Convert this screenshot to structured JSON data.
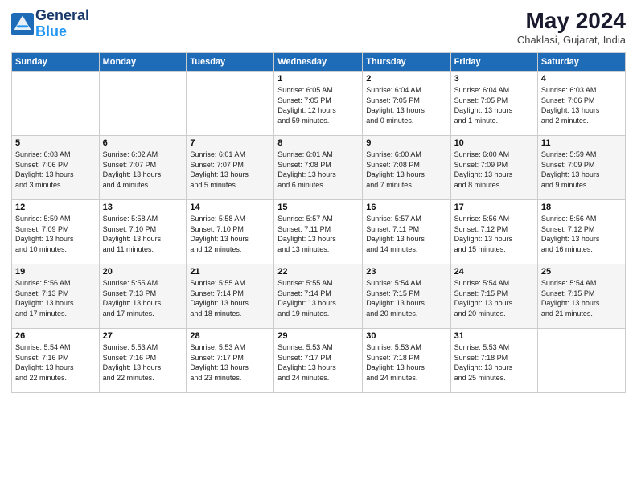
{
  "logo": {
    "line1": "General",
    "line2": "Blue"
  },
  "title": "May 2024",
  "location": "Chaklasi, Gujarat, India",
  "days_header": [
    "Sunday",
    "Monday",
    "Tuesday",
    "Wednesday",
    "Thursday",
    "Friday",
    "Saturday"
  ],
  "weeks": [
    [
      {
        "day": "",
        "info": ""
      },
      {
        "day": "",
        "info": ""
      },
      {
        "day": "",
        "info": ""
      },
      {
        "day": "1",
        "info": "Sunrise: 6:05 AM\nSunset: 7:05 PM\nDaylight: 12 hours\nand 59 minutes."
      },
      {
        "day": "2",
        "info": "Sunrise: 6:04 AM\nSunset: 7:05 PM\nDaylight: 13 hours\nand 0 minutes."
      },
      {
        "day": "3",
        "info": "Sunrise: 6:04 AM\nSunset: 7:05 PM\nDaylight: 13 hours\nand 1 minute."
      },
      {
        "day": "4",
        "info": "Sunrise: 6:03 AM\nSunset: 7:06 PM\nDaylight: 13 hours\nand 2 minutes."
      }
    ],
    [
      {
        "day": "5",
        "info": "Sunrise: 6:03 AM\nSunset: 7:06 PM\nDaylight: 13 hours\nand 3 minutes."
      },
      {
        "day": "6",
        "info": "Sunrise: 6:02 AM\nSunset: 7:07 PM\nDaylight: 13 hours\nand 4 minutes."
      },
      {
        "day": "7",
        "info": "Sunrise: 6:01 AM\nSunset: 7:07 PM\nDaylight: 13 hours\nand 5 minutes."
      },
      {
        "day": "8",
        "info": "Sunrise: 6:01 AM\nSunset: 7:08 PM\nDaylight: 13 hours\nand 6 minutes."
      },
      {
        "day": "9",
        "info": "Sunrise: 6:00 AM\nSunset: 7:08 PM\nDaylight: 13 hours\nand 7 minutes."
      },
      {
        "day": "10",
        "info": "Sunrise: 6:00 AM\nSunset: 7:09 PM\nDaylight: 13 hours\nand 8 minutes."
      },
      {
        "day": "11",
        "info": "Sunrise: 5:59 AM\nSunset: 7:09 PM\nDaylight: 13 hours\nand 9 minutes."
      }
    ],
    [
      {
        "day": "12",
        "info": "Sunrise: 5:59 AM\nSunset: 7:09 PM\nDaylight: 13 hours\nand 10 minutes."
      },
      {
        "day": "13",
        "info": "Sunrise: 5:58 AM\nSunset: 7:10 PM\nDaylight: 13 hours\nand 11 minutes."
      },
      {
        "day": "14",
        "info": "Sunrise: 5:58 AM\nSunset: 7:10 PM\nDaylight: 13 hours\nand 12 minutes."
      },
      {
        "day": "15",
        "info": "Sunrise: 5:57 AM\nSunset: 7:11 PM\nDaylight: 13 hours\nand 13 minutes."
      },
      {
        "day": "16",
        "info": "Sunrise: 5:57 AM\nSunset: 7:11 PM\nDaylight: 13 hours\nand 14 minutes."
      },
      {
        "day": "17",
        "info": "Sunrise: 5:56 AM\nSunset: 7:12 PM\nDaylight: 13 hours\nand 15 minutes."
      },
      {
        "day": "18",
        "info": "Sunrise: 5:56 AM\nSunset: 7:12 PM\nDaylight: 13 hours\nand 16 minutes."
      }
    ],
    [
      {
        "day": "19",
        "info": "Sunrise: 5:56 AM\nSunset: 7:13 PM\nDaylight: 13 hours\nand 17 minutes."
      },
      {
        "day": "20",
        "info": "Sunrise: 5:55 AM\nSunset: 7:13 PM\nDaylight: 13 hours\nand 17 minutes."
      },
      {
        "day": "21",
        "info": "Sunrise: 5:55 AM\nSunset: 7:14 PM\nDaylight: 13 hours\nand 18 minutes."
      },
      {
        "day": "22",
        "info": "Sunrise: 5:55 AM\nSunset: 7:14 PM\nDaylight: 13 hours\nand 19 minutes."
      },
      {
        "day": "23",
        "info": "Sunrise: 5:54 AM\nSunset: 7:15 PM\nDaylight: 13 hours\nand 20 minutes."
      },
      {
        "day": "24",
        "info": "Sunrise: 5:54 AM\nSunset: 7:15 PM\nDaylight: 13 hours\nand 20 minutes."
      },
      {
        "day": "25",
        "info": "Sunrise: 5:54 AM\nSunset: 7:15 PM\nDaylight: 13 hours\nand 21 minutes."
      }
    ],
    [
      {
        "day": "26",
        "info": "Sunrise: 5:54 AM\nSunset: 7:16 PM\nDaylight: 13 hours\nand 22 minutes."
      },
      {
        "day": "27",
        "info": "Sunrise: 5:53 AM\nSunset: 7:16 PM\nDaylight: 13 hours\nand 22 minutes."
      },
      {
        "day": "28",
        "info": "Sunrise: 5:53 AM\nSunset: 7:17 PM\nDaylight: 13 hours\nand 23 minutes."
      },
      {
        "day": "29",
        "info": "Sunrise: 5:53 AM\nSunset: 7:17 PM\nDaylight: 13 hours\nand 24 minutes."
      },
      {
        "day": "30",
        "info": "Sunrise: 5:53 AM\nSunset: 7:18 PM\nDaylight: 13 hours\nand 24 minutes."
      },
      {
        "day": "31",
        "info": "Sunrise: 5:53 AM\nSunset: 7:18 PM\nDaylight: 13 hours\nand 25 minutes."
      },
      {
        "day": "",
        "info": ""
      }
    ]
  ]
}
